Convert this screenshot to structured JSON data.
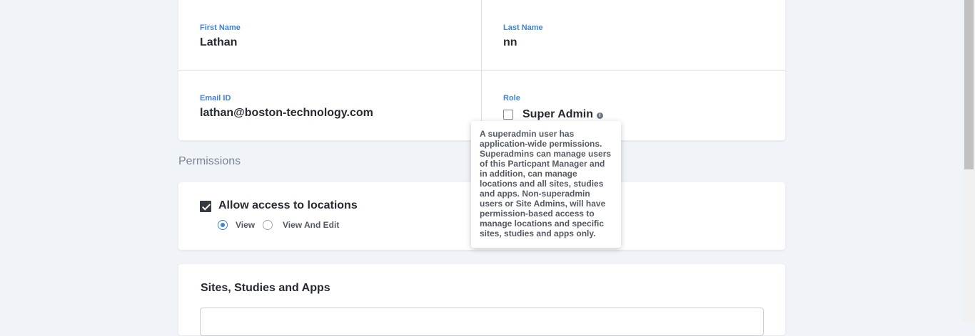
{
  "user": {
    "first_name_label": "First Name",
    "first_name_value": "Lathan",
    "last_name_label": "Last Name",
    "last_name_value": "nn",
    "email_label": "Email ID",
    "email_value": "lathan@boston-technology.com",
    "role_label": "Role",
    "role_option": "Super Admin",
    "role_checked": false,
    "info_icon": "i"
  },
  "tooltip": {
    "text": "A superadmin user has application-wide permissions. Superadmins can manage users of this Particpant Manager and in addition, can manage locations and all sites, studies and apps. Non-superadmin users or Site Admins, will have permission-based access to manage locations and specific sites, studies and apps only."
  },
  "permissions": {
    "heading": "Permissions",
    "locations": {
      "label": "Allow access to locations",
      "checked": true,
      "options": [
        {
          "label": "View",
          "selected": true
        },
        {
          "label": "View And Edit",
          "selected": false
        }
      ]
    },
    "sites": {
      "heading": "Sites, Studies and Apps"
    }
  },
  "colors": {
    "accent": "#3b82e6",
    "background": "#f0f4f8",
    "card": "#ffffff",
    "text": "#262b32"
  }
}
